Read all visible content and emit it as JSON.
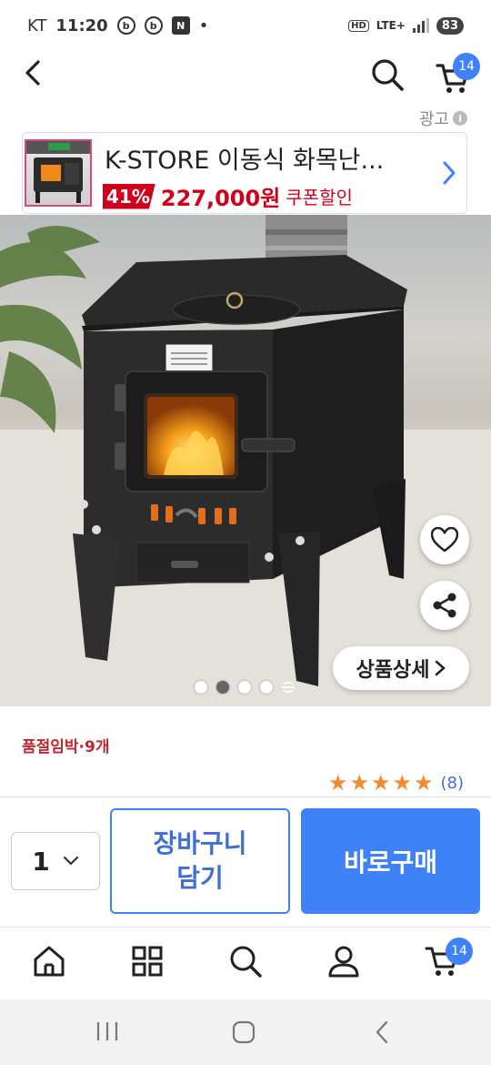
{
  "status_bar": {
    "carrier": "KT",
    "time": "11:20",
    "notif_icons": [
      "b",
      "b",
      "N"
    ],
    "hd": "HD",
    "network": "LTE+",
    "battery": "83"
  },
  "nav": {
    "cart_count": "14"
  },
  "ad": {
    "label": "광고",
    "info": "i",
    "title": "K-STORE 이동식 화목난...",
    "discount": "41%",
    "price": "227,000원",
    "coupon": "쿠폰할인"
  },
  "hero": {
    "detail_label": "상품상세",
    "slide_count": 4,
    "active_slide": 2
  },
  "product": {
    "stock_notice": "품절임박·9개",
    "rating": 5,
    "review_count": "(8)"
  },
  "purchase": {
    "quantity": "1",
    "cart_button_line1": "장바구니",
    "cart_button_line2": "담기",
    "buy_button": "바로구매"
  },
  "tabbar": {
    "cart_count": "14"
  },
  "colors": {
    "accent": "#3f82f7",
    "sale_red": "#d0011b",
    "star": "#f28a30"
  }
}
